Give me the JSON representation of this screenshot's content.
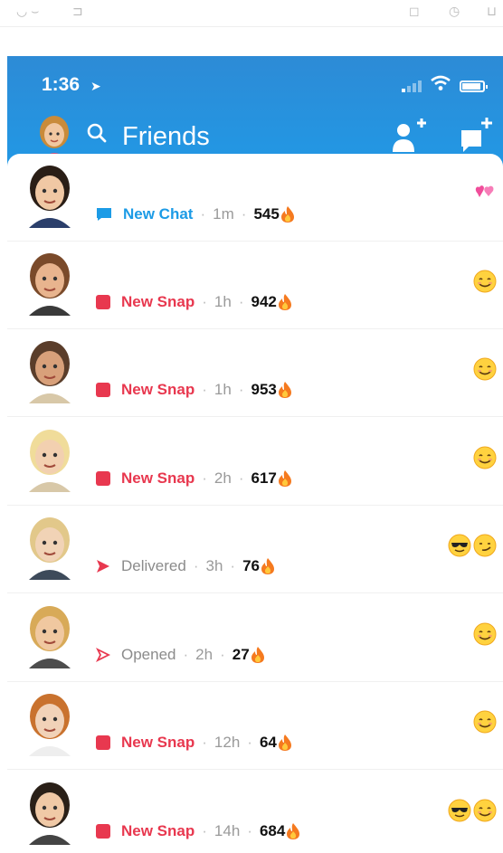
{
  "status_bar": {
    "time": "1:36"
  },
  "nav": {
    "title": "Friends"
  },
  "friends": [
    {
      "status_type": "new-chat",
      "status_label": "New Chat",
      "ago": "1m",
      "streak": "545",
      "emojis": [
        "two-hearts"
      ]
    },
    {
      "status_type": "new-snap",
      "status_label": "New Snap",
      "ago": "1h",
      "streak": "942",
      "emojis": [
        "smile"
      ]
    },
    {
      "status_type": "new-snap",
      "status_label": "New Snap",
      "ago": "1h",
      "streak": "953",
      "emojis": [
        "smile"
      ]
    },
    {
      "status_type": "new-snap",
      "status_label": "New Snap",
      "ago": "2h",
      "streak": "617",
      "emojis": [
        "smile"
      ]
    },
    {
      "status_type": "delivered",
      "status_label": "Delivered",
      "ago": "3h",
      "streak": "76",
      "emojis": [
        "sunglasses",
        "smirk"
      ]
    },
    {
      "status_type": "opened",
      "status_label": "Opened",
      "ago": "2h",
      "streak": "27",
      "emojis": [
        "smile"
      ]
    },
    {
      "status_type": "new-snap",
      "status_label": "New Snap",
      "ago": "12h",
      "streak": "64",
      "emojis": [
        "smile"
      ]
    },
    {
      "status_type": "new-snap",
      "status_label": "New Snap",
      "ago": "14h",
      "streak": "684",
      "emojis": [
        "sunglasses",
        "smile"
      ]
    }
  ],
  "colors": {
    "header": "#1f9be8",
    "snap_red": "#e8384f",
    "chat_blue": "#1c9be6"
  }
}
